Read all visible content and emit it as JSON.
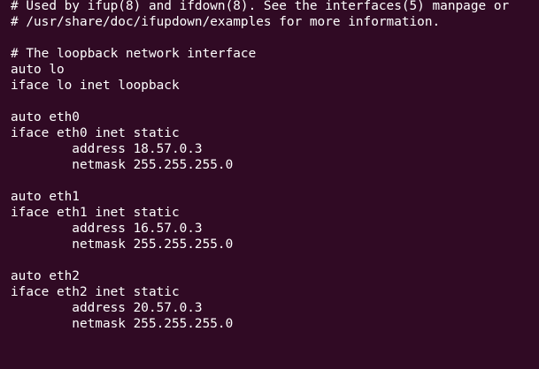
{
  "terminal": {
    "background": "#300a24",
    "foreground": "#ffffff",
    "lines": [
      "# Used by ifup(8) and ifdown(8). See the interfaces(5) manpage or",
      "# /usr/share/doc/ifupdown/examples for more information.",
      "",
      "# The loopback network interface",
      "auto lo",
      "iface lo inet loopback",
      "",
      "auto eth0",
      "iface eth0 inet static",
      "        address 18.57.0.3",
      "        netmask 255.255.255.0",
      "",
      "auto eth1",
      "iface eth1 inet static",
      "        address 16.57.0.3",
      "        netmask 255.255.255.0",
      "",
      "auto eth2",
      "iface eth2 inet static",
      "        address 20.57.0.3",
      "        netmask 255.255.255.0"
    ]
  }
}
